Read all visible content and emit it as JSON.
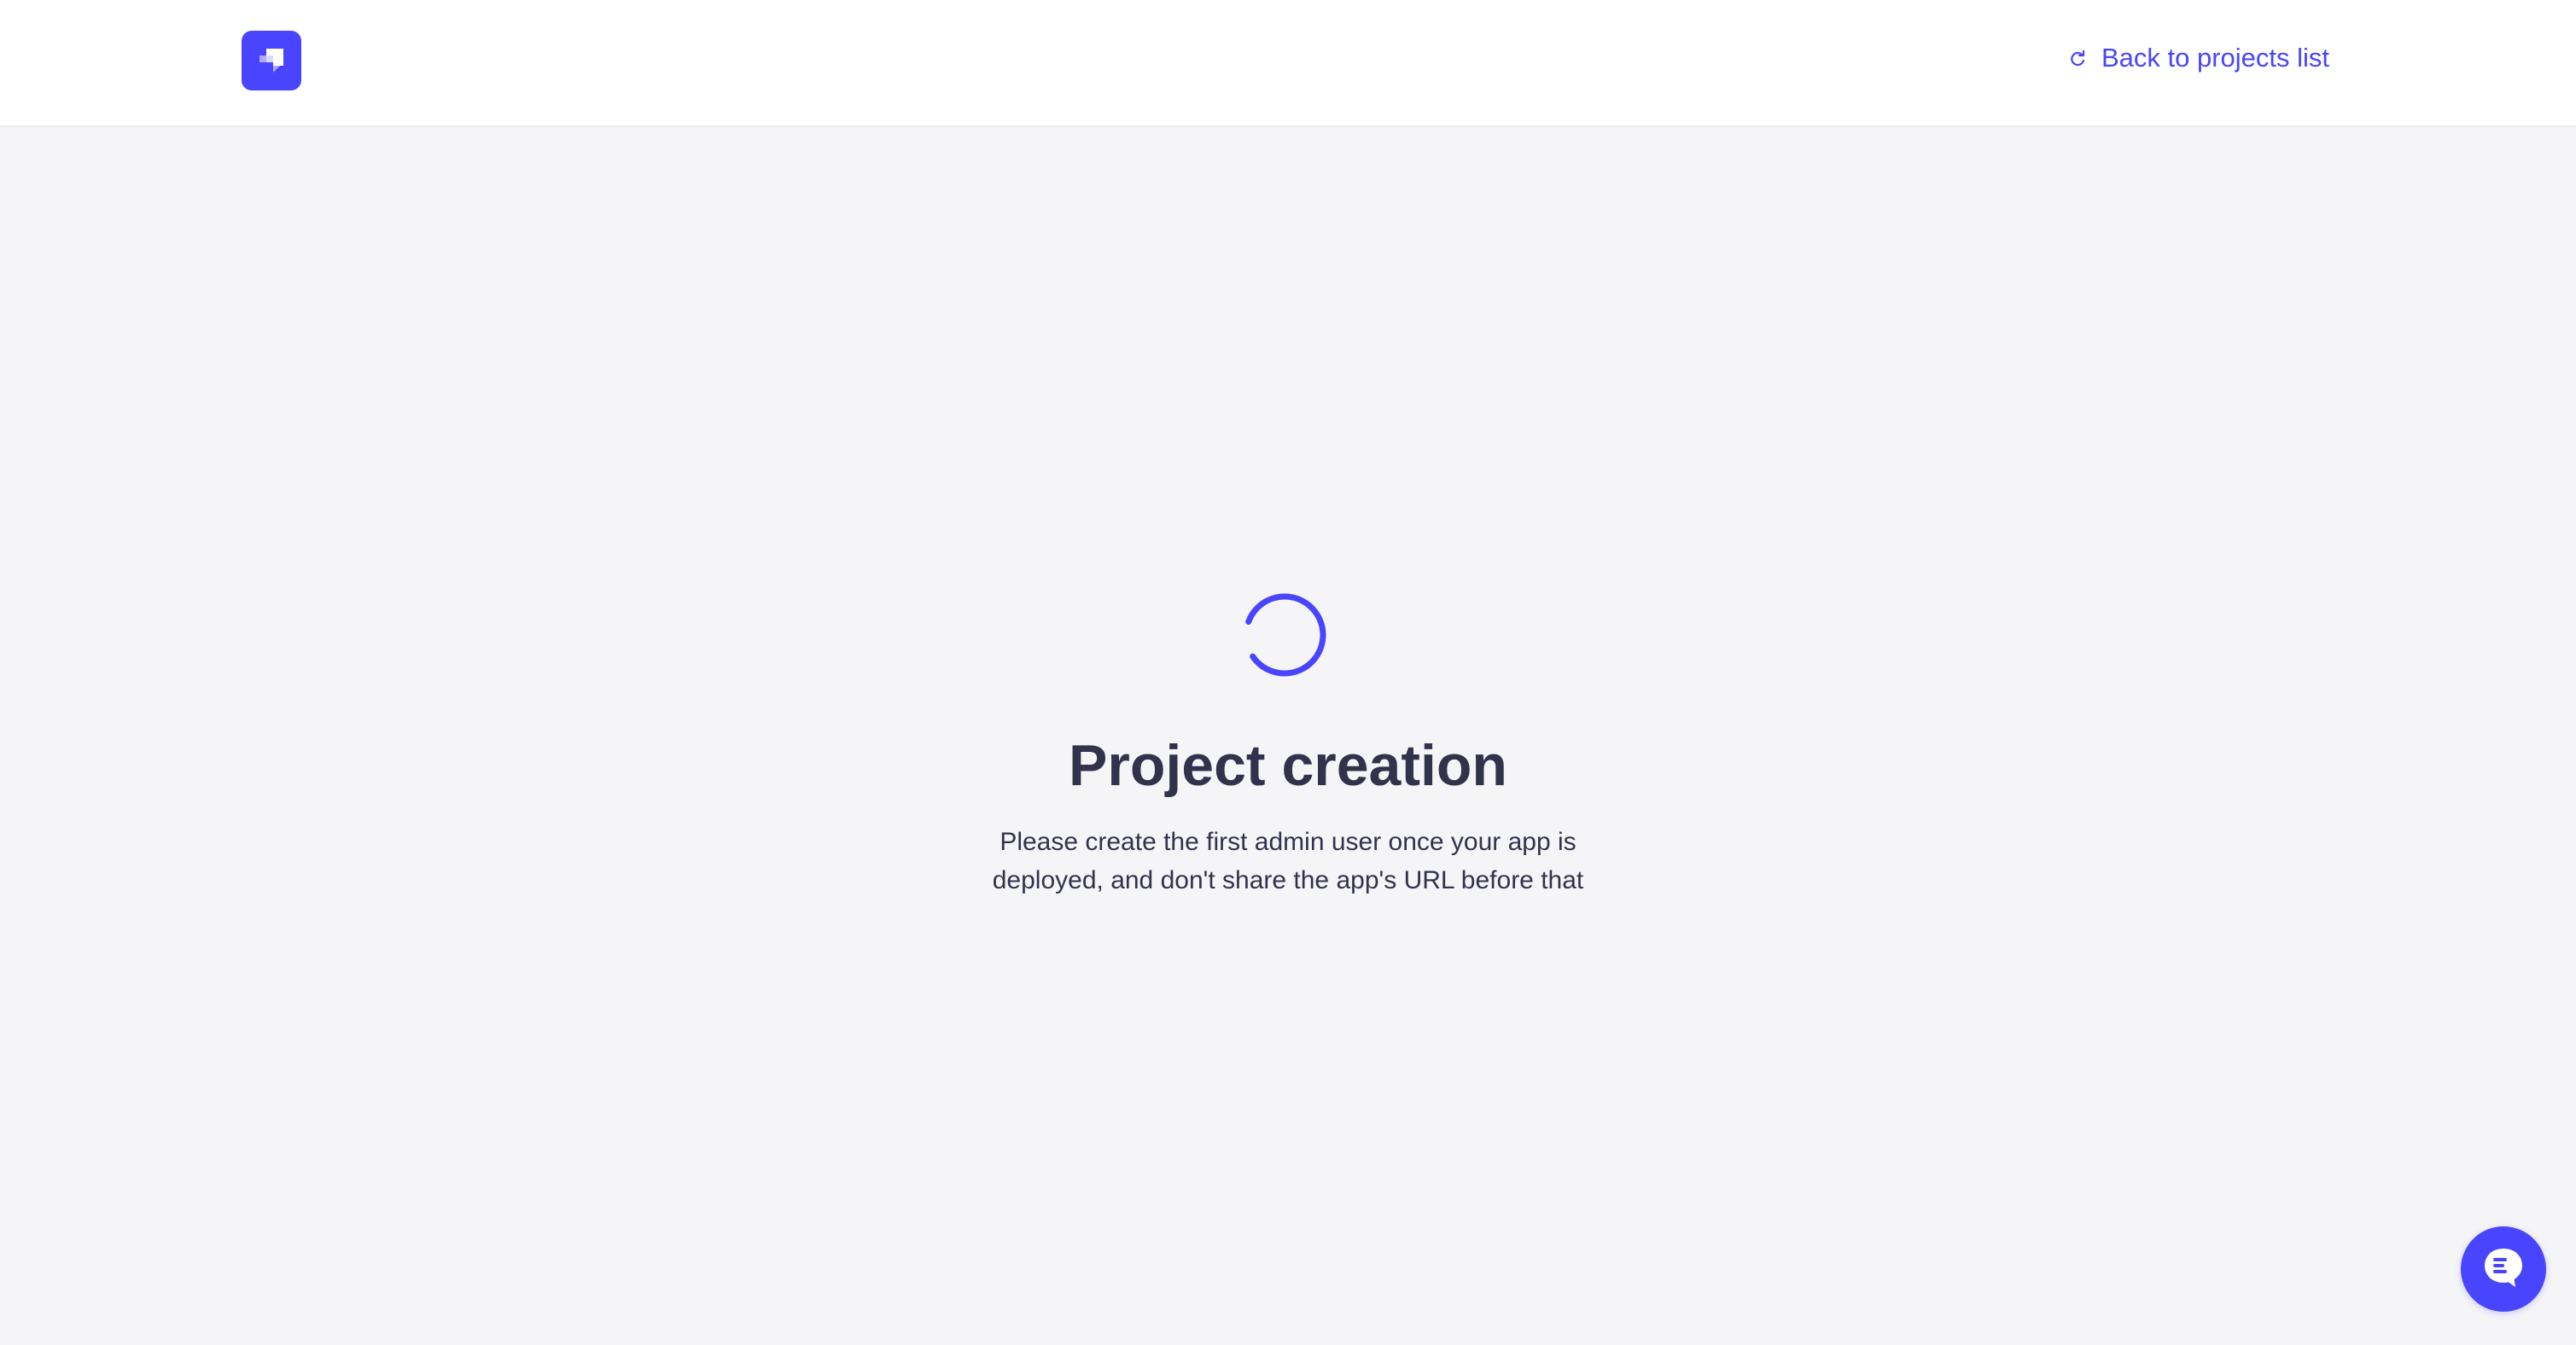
{
  "header": {
    "logo_icon": "strapi-logo-icon",
    "back_link_icon": "redo-arrow-icon",
    "back_link_label": "Back to projects list"
  },
  "main": {
    "spinner_icon": "loading-spinner-icon",
    "title": "Project creation",
    "description": "Please create the first admin user once your app is deployed, and don't share the app's URL before that"
  },
  "chat": {
    "icon": "chat-bubble-icon"
  },
  "colors": {
    "accent": "#4945ff",
    "text": "#32324d",
    "background": "#f5f5f7",
    "header_background": "#ffffff"
  }
}
